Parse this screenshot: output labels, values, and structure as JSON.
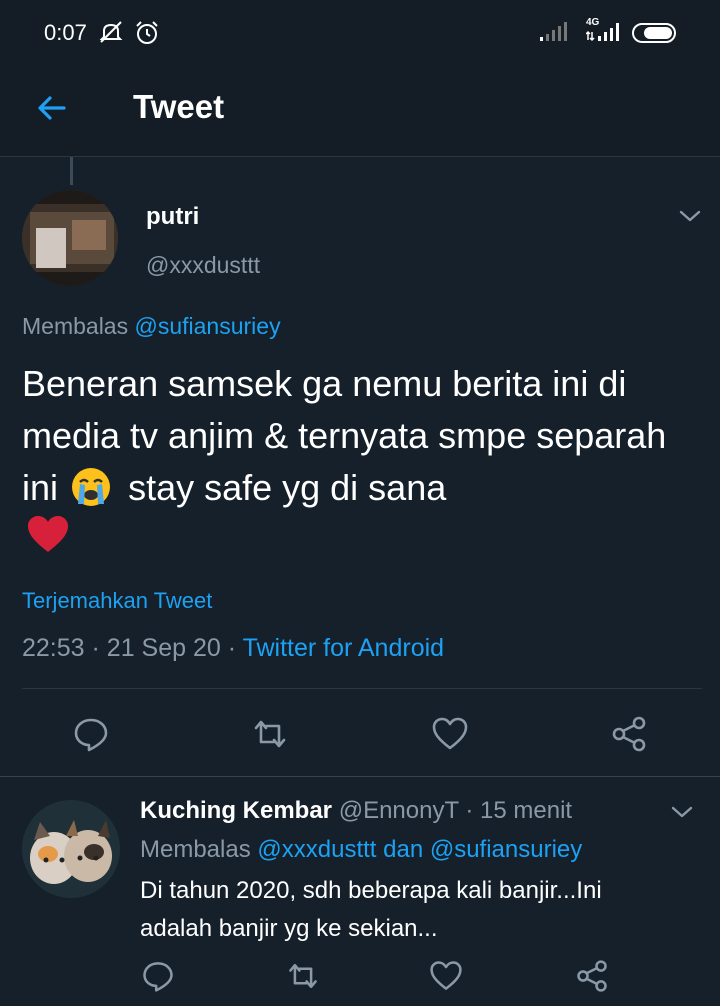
{
  "status_bar": {
    "time": "0:07",
    "network": "4G"
  },
  "header": {
    "title": "Tweet"
  },
  "tweet": {
    "author_name": "putri",
    "author_handle": "@xxxdusttt",
    "replying_label": "Membalas",
    "replying_to": "@sufiansuriey",
    "text_part1": "Beneran samsek ga nemu berita ini di media tv anjim & ternyata smpe separah ini",
    "text_part2": "stay safe yg di sana",
    "translate_label": "Terjemahkan Tweet",
    "time": "22:53",
    "date": "21 Sep 20",
    "source": "Twitter for Android"
  },
  "reply": {
    "author_name": "Kuching Kembar",
    "author_handle": "@EnnonyT",
    "time_ago": "15 menit",
    "replying_label": "Membalas",
    "replying_to": "@xxxdusttt dan @sufiansuriey",
    "text": "Di tahun 2020, sdh beberapa kali banjir...Ini adalah banjir yg ke sekian..."
  },
  "colors": {
    "background": "#15202b",
    "accent": "#1da1f2",
    "secondary_text": "#8b99a6",
    "heart": "#e0245e"
  },
  "icons": [
    "back-arrow-icon",
    "reply-icon",
    "retweet-icon",
    "like-icon",
    "share-icon",
    "chevron-down-icon",
    "loudly-crying-emoji",
    "red-heart-emoji"
  ]
}
